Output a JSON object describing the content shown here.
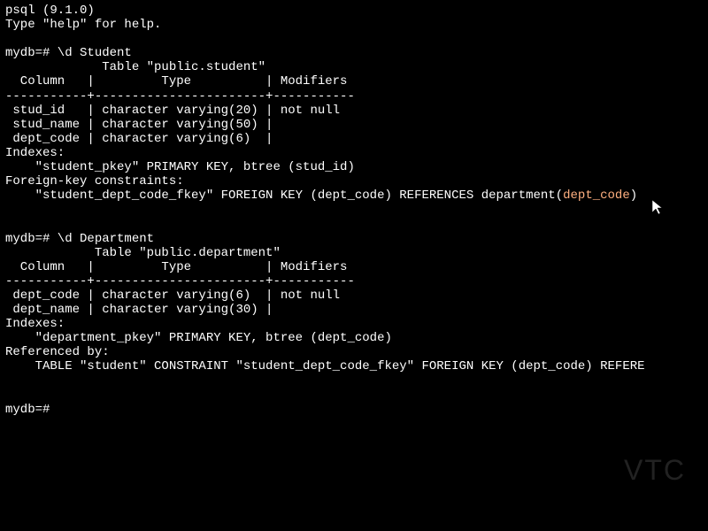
{
  "header": {
    "line1": "psql (9.1.0)",
    "line2": "Type \"help\" for help."
  },
  "student_section": {
    "prompt": "mydb=# \\d Student",
    "title": "             Table \"public.student\"",
    "header": "  Column   |         Type          | Modifiers",
    "divider": "-----------+-----------------------+-----------",
    "row1": " stud_id   | character varying(20) | not null",
    "row2": " stud_name | character varying(50) |",
    "row3": " dept_code | character varying(6)  |",
    "indexes_label": "Indexes:",
    "indexes_line": "    \"student_pkey\" PRIMARY KEY, btree (stud_id)",
    "fk_label": "Foreign-key constraints:",
    "fk_line_prefix": "    \"student_dept_code_fkey\" FOREIGN KEY (dept_code) REFERENCES department(",
    "fk_highlight": "dept_code",
    "fk_line_suffix": ")"
  },
  "department_section": {
    "prompt": "mydb=# \\d Department",
    "title": "            Table \"public.department\"",
    "header": "  Column   |         Type          | Modifiers",
    "divider": "-----------+-----------------------+-----------",
    "row1": " dept_code | character varying(6)  | not null",
    "row2": " dept_name | character varying(30) |",
    "indexes_label": "Indexes:",
    "indexes_line": "    \"department_pkey\" PRIMARY KEY, btree (dept_code)",
    "ref_label": "Referenced by:",
    "ref_line": "    TABLE \"student\" CONSTRAINT \"student_dept_code_fkey\" FOREIGN KEY (dept_code) REFERE"
  },
  "final_prompt": "mydb=#",
  "watermark": "VTC"
}
